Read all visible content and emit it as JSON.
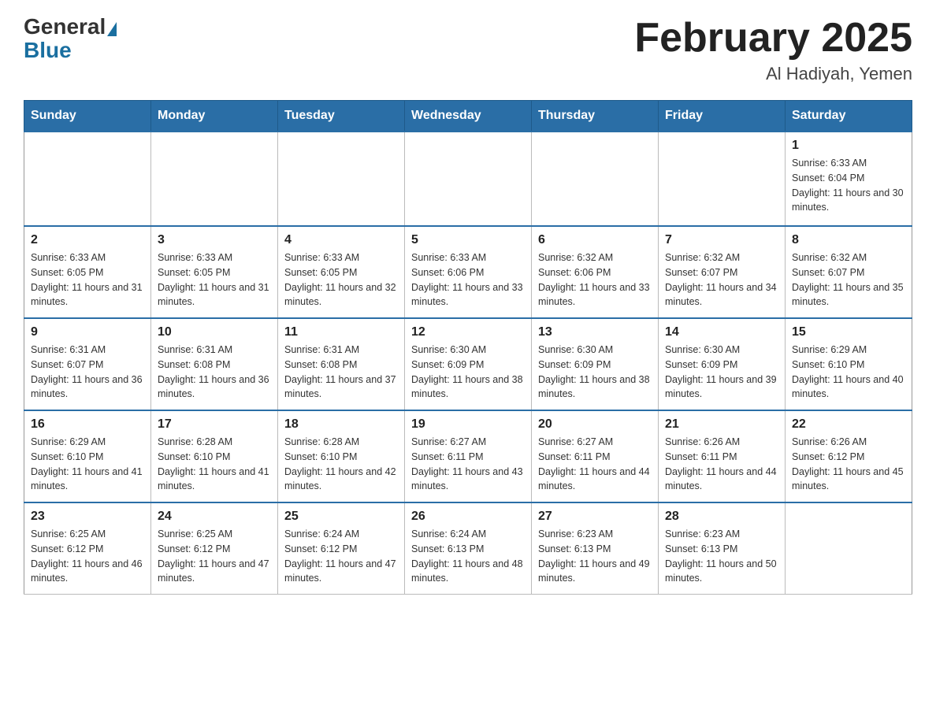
{
  "header": {
    "logo_general": "General",
    "logo_blue": "Blue",
    "title": "February 2025",
    "subtitle": "Al Hadiyah, Yemen"
  },
  "days": [
    "Sunday",
    "Monday",
    "Tuesday",
    "Wednesday",
    "Thursday",
    "Friday",
    "Saturday"
  ],
  "weeks": [
    [
      {
        "day": "",
        "info": ""
      },
      {
        "day": "",
        "info": ""
      },
      {
        "day": "",
        "info": ""
      },
      {
        "day": "",
        "info": ""
      },
      {
        "day": "",
        "info": ""
      },
      {
        "day": "",
        "info": ""
      },
      {
        "day": "1",
        "info": "Sunrise: 6:33 AM\nSunset: 6:04 PM\nDaylight: 11 hours and 30 minutes."
      }
    ],
    [
      {
        "day": "2",
        "info": "Sunrise: 6:33 AM\nSunset: 6:05 PM\nDaylight: 11 hours and 31 minutes."
      },
      {
        "day": "3",
        "info": "Sunrise: 6:33 AM\nSunset: 6:05 PM\nDaylight: 11 hours and 31 minutes."
      },
      {
        "day": "4",
        "info": "Sunrise: 6:33 AM\nSunset: 6:05 PM\nDaylight: 11 hours and 32 minutes."
      },
      {
        "day": "5",
        "info": "Sunrise: 6:33 AM\nSunset: 6:06 PM\nDaylight: 11 hours and 33 minutes."
      },
      {
        "day": "6",
        "info": "Sunrise: 6:32 AM\nSunset: 6:06 PM\nDaylight: 11 hours and 33 minutes."
      },
      {
        "day": "7",
        "info": "Sunrise: 6:32 AM\nSunset: 6:07 PM\nDaylight: 11 hours and 34 minutes."
      },
      {
        "day": "8",
        "info": "Sunrise: 6:32 AM\nSunset: 6:07 PM\nDaylight: 11 hours and 35 minutes."
      }
    ],
    [
      {
        "day": "9",
        "info": "Sunrise: 6:31 AM\nSunset: 6:07 PM\nDaylight: 11 hours and 36 minutes."
      },
      {
        "day": "10",
        "info": "Sunrise: 6:31 AM\nSunset: 6:08 PM\nDaylight: 11 hours and 36 minutes."
      },
      {
        "day": "11",
        "info": "Sunrise: 6:31 AM\nSunset: 6:08 PM\nDaylight: 11 hours and 37 minutes."
      },
      {
        "day": "12",
        "info": "Sunrise: 6:30 AM\nSunset: 6:09 PM\nDaylight: 11 hours and 38 minutes."
      },
      {
        "day": "13",
        "info": "Sunrise: 6:30 AM\nSunset: 6:09 PM\nDaylight: 11 hours and 38 minutes."
      },
      {
        "day": "14",
        "info": "Sunrise: 6:30 AM\nSunset: 6:09 PM\nDaylight: 11 hours and 39 minutes."
      },
      {
        "day": "15",
        "info": "Sunrise: 6:29 AM\nSunset: 6:10 PM\nDaylight: 11 hours and 40 minutes."
      }
    ],
    [
      {
        "day": "16",
        "info": "Sunrise: 6:29 AM\nSunset: 6:10 PM\nDaylight: 11 hours and 41 minutes."
      },
      {
        "day": "17",
        "info": "Sunrise: 6:28 AM\nSunset: 6:10 PM\nDaylight: 11 hours and 41 minutes."
      },
      {
        "day": "18",
        "info": "Sunrise: 6:28 AM\nSunset: 6:10 PM\nDaylight: 11 hours and 42 minutes."
      },
      {
        "day": "19",
        "info": "Sunrise: 6:27 AM\nSunset: 6:11 PM\nDaylight: 11 hours and 43 minutes."
      },
      {
        "day": "20",
        "info": "Sunrise: 6:27 AM\nSunset: 6:11 PM\nDaylight: 11 hours and 44 minutes."
      },
      {
        "day": "21",
        "info": "Sunrise: 6:26 AM\nSunset: 6:11 PM\nDaylight: 11 hours and 44 minutes."
      },
      {
        "day": "22",
        "info": "Sunrise: 6:26 AM\nSunset: 6:12 PM\nDaylight: 11 hours and 45 minutes."
      }
    ],
    [
      {
        "day": "23",
        "info": "Sunrise: 6:25 AM\nSunset: 6:12 PM\nDaylight: 11 hours and 46 minutes."
      },
      {
        "day": "24",
        "info": "Sunrise: 6:25 AM\nSunset: 6:12 PM\nDaylight: 11 hours and 47 minutes."
      },
      {
        "day": "25",
        "info": "Sunrise: 6:24 AM\nSunset: 6:12 PM\nDaylight: 11 hours and 47 minutes."
      },
      {
        "day": "26",
        "info": "Sunrise: 6:24 AM\nSunset: 6:13 PM\nDaylight: 11 hours and 48 minutes."
      },
      {
        "day": "27",
        "info": "Sunrise: 6:23 AM\nSunset: 6:13 PM\nDaylight: 11 hours and 49 minutes."
      },
      {
        "day": "28",
        "info": "Sunrise: 6:23 AM\nSunset: 6:13 PM\nDaylight: 11 hours and 50 minutes."
      },
      {
        "day": "",
        "info": ""
      }
    ]
  ]
}
